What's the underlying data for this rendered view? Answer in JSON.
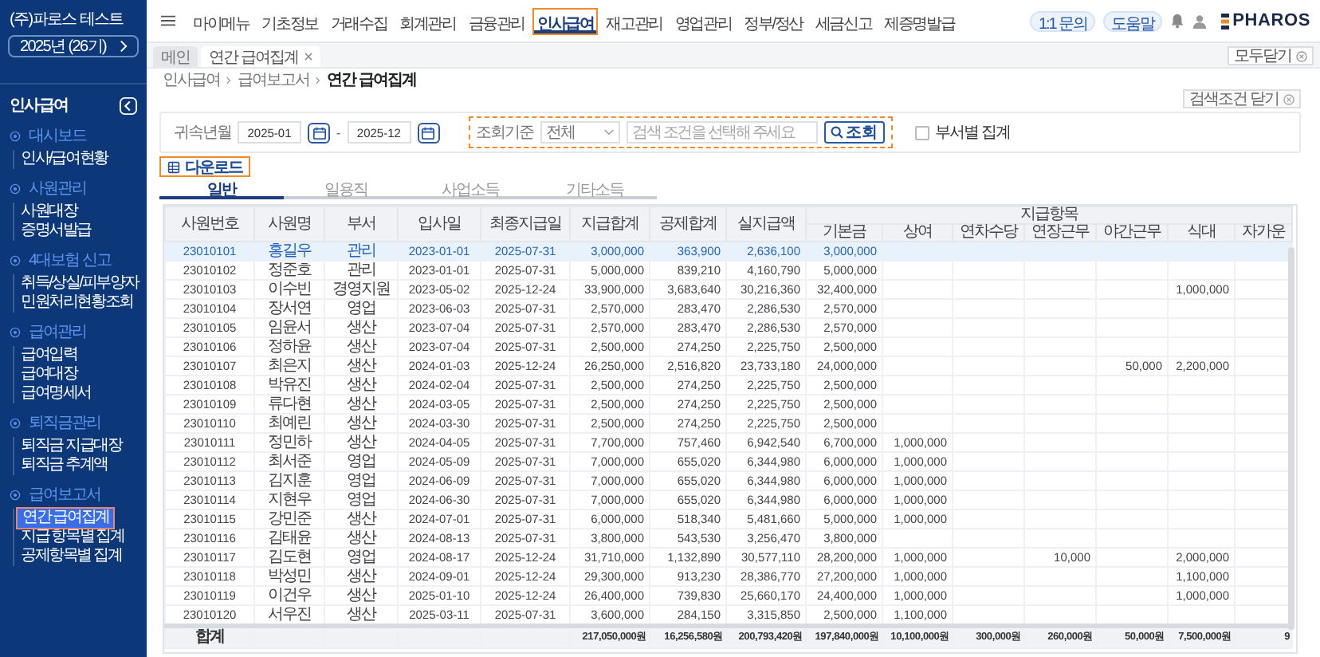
{
  "company": {
    "name": "(주)파로스 테스트",
    "period": "2025년 (26기)"
  },
  "sidebar": {
    "title": "인사급여",
    "groups": [
      {
        "label": "대시보드",
        "items": [
          {
            "label": "인사/급여현황",
            "selected": false
          }
        ]
      },
      {
        "label": "사원관리",
        "items": [
          {
            "label": "사원대장",
            "selected": false
          },
          {
            "label": "증명서발급",
            "selected": false
          }
        ]
      },
      {
        "label": "4대보험 신고",
        "items": [
          {
            "label": "취득/상실/피부양자",
            "selected": false
          },
          {
            "label": "민원처리현황조회",
            "selected": false
          }
        ]
      },
      {
        "label": "급여관리",
        "items": [
          {
            "label": "급여입력",
            "selected": false
          },
          {
            "label": "급여대장",
            "selected": false
          },
          {
            "label": "급여명세서",
            "selected": false
          }
        ]
      },
      {
        "label": "퇴직금관리",
        "items": [
          {
            "label": "퇴직금 지급대장",
            "selected": false
          },
          {
            "label": "퇴직금 추계액",
            "selected": false
          }
        ]
      },
      {
        "label": "급여보고서",
        "items": [
          {
            "label": "연간 급여집계",
            "selected": true
          },
          {
            "label": "지급 항목별 집계",
            "selected": false
          },
          {
            "label": "공제항목별 집계",
            "selected": false
          }
        ]
      }
    ]
  },
  "top_nav": {
    "menu": [
      {
        "label": "마이메뉴",
        "selected": false
      },
      {
        "label": "기초정보",
        "selected": false
      },
      {
        "label": "거래수집",
        "selected": false
      },
      {
        "label": "회계관리",
        "selected": false
      },
      {
        "label": "금융관리",
        "selected": false
      },
      {
        "label": "인사급여",
        "selected": true
      },
      {
        "label": "재고관리",
        "selected": false
      },
      {
        "label": "영업관리",
        "selected": false
      },
      {
        "label": "정부/정산",
        "selected": false
      },
      {
        "label": "세금신고",
        "selected": false
      },
      {
        "label": "제증명발급",
        "selected": false
      }
    ],
    "actions": [
      "1:1 문의",
      "도움말"
    ],
    "logo": "PHAROS"
  },
  "open_tabs": [
    {
      "label": "메인",
      "selected": false,
      "closable": false
    },
    {
      "label": "연간 급여집계",
      "selected": true,
      "closable": true
    }
  ],
  "close_all": "모두닫기",
  "breadcrumb": [
    "인사급여",
    "급여보고서",
    "연간 급여집계"
  ],
  "toggle_filter": "검색조건 닫기",
  "filter": {
    "period_label": "귀속년월",
    "from": "2025-01",
    "separator": "-",
    "to": "2025-12",
    "criteria_label": "조회기준",
    "criteria_value": "전체",
    "search_placeholder": "검색 조건을 선택해 주세요",
    "search_button": "조회",
    "dept_checkbox": {
      "label": "부서별 집계",
      "checked": false
    }
  },
  "download": "다운로드",
  "sub_tabs": [
    {
      "label": "일반",
      "selected": true
    },
    {
      "label": "일용직",
      "selected": false
    },
    {
      "label": "사업소득",
      "selected": false
    },
    {
      "label": "기타소득",
      "selected": false
    }
  ],
  "table": {
    "columns": [
      "사원번호",
      "사원명",
      "부서",
      "입사일",
      "최종지급일",
      "지급합계",
      "공제합계",
      "실지급액"
    ],
    "group_header": "지급항목",
    "pay_columns": [
      "기본금",
      "상여",
      "연차수당",
      "연장근무",
      "야간근무",
      "식대",
      "자가운"
    ],
    "rows": [
      {
        "selected": true,
        "cells": [
          "23010101",
          "홍길우",
          "관리",
          "2023-01-01",
          "2025-07-31",
          "3,000,000",
          "363,900",
          "2,636,100"
        ],
        "pay": [
          {
            "kind": "base",
            "value": "3,000,000"
          }
        ]
      },
      {
        "selected": false,
        "cells": [
          "23010102",
          "정준호",
          "관리",
          "2023-01-01",
          "2025-07-31",
          "5,000,000",
          "839,210",
          "4,160,790"
        ],
        "pay": [
          {
            "kind": "base",
            "value": "5,000,000"
          }
        ]
      },
      {
        "selected": false,
        "cells": [
          "23010103",
          "이수빈",
          "경영지원",
          "2023-05-02",
          "2025-12-24",
          "33,900,000",
          "3,683,640",
          "30,216,360"
        ],
        "pay": [
          {
            "kind": "base",
            "value": "32,400,000"
          },
          {
            "kind": "meal",
            "value": "1,000,000"
          }
        ]
      },
      {
        "selected": false,
        "cells": [
          "23010104",
          "장서연",
          "영업",
          "2023-06-03",
          "2025-07-31",
          "2,570,000",
          "283,470",
          "2,286,530"
        ],
        "pay": [
          {
            "kind": "base",
            "value": "2,570,000"
          }
        ]
      },
      {
        "selected": false,
        "cells": [
          "23010105",
          "임윤서",
          "생산",
          "2023-07-04",
          "2025-07-31",
          "2,570,000",
          "283,470",
          "2,286,530"
        ],
        "pay": [
          {
            "kind": "base",
            "value": "2,570,000"
          }
        ]
      },
      {
        "selected": false,
        "cells": [
          "23010106",
          "정하윤",
          "생산",
          "2023-07-04",
          "2025-07-31",
          "2,500,000",
          "274,250",
          "2,225,750"
        ],
        "pay": [
          {
            "kind": "base",
            "value": "2,500,000"
          }
        ]
      },
      {
        "selected": false,
        "cells": [
          "23010107",
          "최은지",
          "생산",
          "2024-01-03",
          "2025-12-24",
          "26,250,000",
          "2,516,820",
          "23,733,180"
        ],
        "pay": [
          {
            "kind": "base",
            "value": "24,000,000"
          },
          {
            "kind": "night",
            "value": "50,000"
          },
          {
            "kind": "meal",
            "value": "2,200,000"
          }
        ]
      },
      {
        "selected": false,
        "cells": [
          "23010108",
          "박유진",
          "생산",
          "2024-02-04",
          "2025-07-31",
          "2,500,000",
          "274,250",
          "2,225,750"
        ],
        "pay": [
          {
            "kind": "base",
            "value": "2,500,000"
          }
        ]
      },
      {
        "selected": false,
        "cells": [
          "23010109",
          "류다현",
          "생산",
          "2024-03-05",
          "2025-07-31",
          "2,500,000",
          "274,250",
          "2,225,750"
        ],
        "pay": [
          {
            "kind": "base",
            "value": "2,500,000"
          }
        ]
      },
      {
        "selected": false,
        "cells": [
          "23010110",
          "최예린",
          "생산",
          "2024-03-30",
          "2025-07-31",
          "2,500,000",
          "274,250",
          "2,225,750"
        ],
        "pay": [
          {
            "kind": "base",
            "value": "2,500,000"
          }
        ]
      },
      {
        "selected": false,
        "cells": [
          "23010111",
          "정민하",
          "생산",
          "2024-04-05",
          "2025-07-31",
          "7,700,000",
          "757,460",
          "6,942,540"
        ],
        "pay": [
          {
            "kind": "base",
            "value": "6,700,000"
          },
          {
            "kind": "bonus",
            "value": "1,000,000"
          }
        ]
      },
      {
        "selected": false,
        "cells": [
          "23010112",
          "최서준",
          "영업",
          "2024-05-09",
          "2025-07-31",
          "7,000,000",
          "655,020",
          "6,344,980"
        ],
        "pay": [
          {
            "kind": "base",
            "value": "6,000,000"
          },
          {
            "kind": "bonus",
            "value": "1,000,000"
          }
        ]
      },
      {
        "selected": false,
        "cells": [
          "23010113",
          "김지훈",
          "영업",
          "2024-06-09",
          "2025-07-31",
          "7,000,000",
          "655,020",
          "6,344,980"
        ],
        "pay": [
          {
            "kind": "base",
            "value": "6,000,000"
          },
          {
            "kind": "bonus",
            "value": "1,000,000"
          }
        ]
      },
      {
        "selected": false,
        "cells": [
          "23010114",
          "지현우",
          "영업",
          "2024-06-30",
          "2025-07-31",
          "7,000,000",
          "655,020",
          "6,344,980"
        ],
        "pay": [
          {
            "kind": "base",
            "value": "6,000,000"
          },
          {
            "kind": "bonus",
            "value": "1,000,000"
          }
        ]
      },
      {
        "selected": false,
        "cells": [
          "23010115",
          "강민준",
          "생산",
          "2024-07-01",
          "2025-07-31",
          "6,000,000",
          "518,340",
          "5,481,660"
        ],
        "pay": [
          {
            "kind": "base",
            "value": "5,000,000"
          },
          {
            "kind": "bonus",
            "value": "1,000,000"
          }
        ]
      },
      {
        "selected": false,
        "cells": [
          "23010116",
          "김태윤",
          "생산",
          "2024-08-13",
          "2025-07-31",
          "3,800,000",
          "543,530",
          "3,256,470"
        ],
        "pay": [
          {
            "kind": "base",
            "value": "3,800,000"
          }
        ]
      },
      {
        "selected": false,
        "cells": [
          "23010117",
          "김도현",
          "영업",
          "2024-08-17",
          "2025-12-24",
          "31,710,000",
          "1,132,890",
          "30,577,110"
        ],
        "pay": [
          {
            "kind": "base",
            "value": "28,200,000"
          },
          {
            "kind": "bonus",
            "value": "1,000,000"
          },
          {
            "kind": "overtime",
            "value": "10,000"
          },
          {
            "kind": "meal",
            "value": "2,000,000"
          }
        ]
      },
      {
        "selected": false,
        "cells": [
          "23010118",
          "박성민",
          "생산",
          "2024-09-01",
          "2025-12-24",
          "29,300,000",
          "913,230",
          "28,386,770"
        ],
        "pay": [
          {
            "kind": "base",
            "value": "27,200,000"
          },
          {
            "kind": "bonus",
            "value": "1,000,000"
          },
          {
            "kind": "meal",
            "value": "1,100,000"
          }
        ]
      },
      {
        "selected": false,
        "cells": [
          "23010119",
          "이건우",
          "생산",
          "2025-01-10",
          "2025-12-24",
          "26,400,000",
          "739,830",
          "25,660,170"
        ],
        "pay": [
          {
            "kind": "base",
            "value": "24,400,000"
          },
          {
            "kind": "bonus",
            "value": "1,000,000"
          },
          {
            "kind": "meal",
            "value": "1,000,000"
          }
        ]
      },
      {
        "selected": false,
        "cells": [
          "23010120",
          "서우진",
          "생산",
          "2025-03-11",
          "2025-07-31",
          "3,600,000",
          "284,150",
          "3,315,850"
        ],
        "pay": [
          {
            "kind": "base",
            "value": "2,500,000"
          },
          {
            "kind": "bonus",
            "value": "1,100,000"
          }
        ]
      }
    ],
    "totals": {
      "label": "합계",
      "cells": [
        "217,050,000원",
        "16,256,580원",
        "200,793,420원"
      ],
      "pay": [
        "197,840,000원",
        "10,100,000원",
        "300,000원",
        "260,000원",
        "50,000원",
        "7,500,000원",
        "9"
      ]
    }
  }
}
